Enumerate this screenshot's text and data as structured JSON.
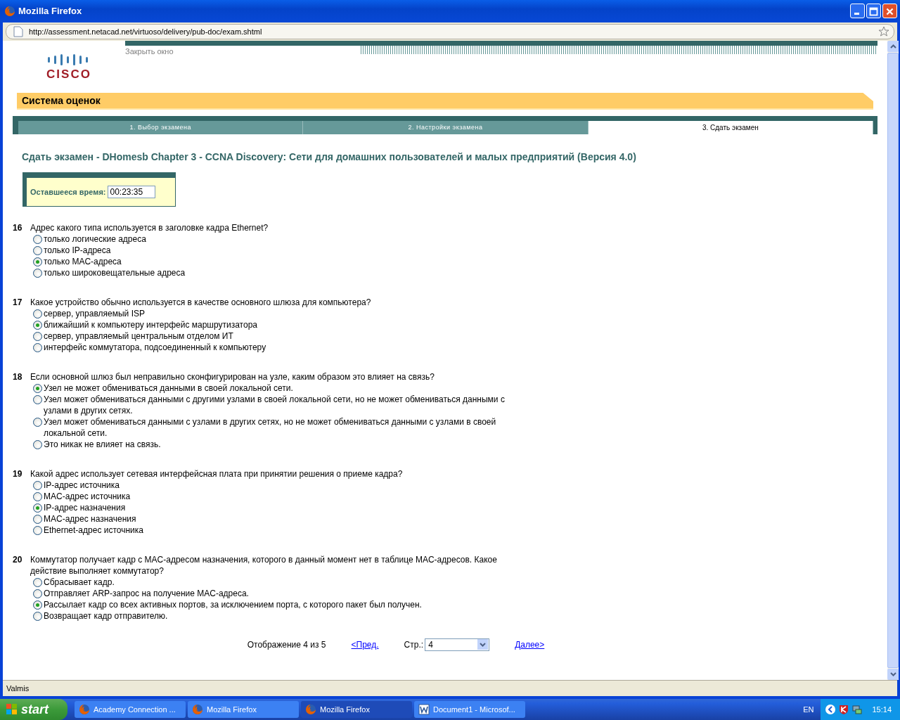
{
  "window": {
    "title": "Mozilla Firefox"
  },
  "address_bar": {
    "url": "http://assessment.netacad.net/virtuoso/delivery/pub-doc/exam.shtml"
  },
  "header": {
    "close_link": "Закрыть окно",
    "logo": "CISCO",
    "banner": "Система оценок"
  },
  "steps": [
    {
      "label": "1. Выбор экзамена",
      "selected": false
    },
    {
      "label": "2. Настройки экзамена",
      "selected": false
    },
    {
      "label": "3. Сдать экзамен",
      "selected": true
    }
  ],
  "exam_title": "Сдать экзамен - DHomesb Chapter 3 - CCNA Discovery: Сети для домашних пользователей и малых предприятий (Версия 4.0)",
  "timer": {
    "label": "Оставшееся время:",
    "value": "00:23:35"
  },
  "questions": [
    {
      "number": "16",
      "text": "Адрес какого типа используется в заголовке кадра Ethernet?",
      "options": [
        {
          "label": "только логические адреса",
          "selected": false
        },
        {
          "label": "только IP-адреса",
          "selected": false
        },
        {
          "label": "только MAC-адреса",
          "selected": true
        },
        {
          "label": "только широковещательные адреса",
          "selected": false
        }
      ]
    },
    {
      "number": "17",
      "text": "Какое устройство обычно используется в качестве основного шлюза для компьютера?",
      "options": [
        {
          "label": "сервер, управляемый ISP",
          "selected": false
        },
        {
          "label": "ближайший к компьютеру интерфейс маршрутизатора",
          "selected": true
        },
        {
          "label": "сервер, управляемый центральным отделом ИТ",
          "selected": false
        },
        {
          "label": "интерфейс коммутатора, подсоединенный к компьютеру",
          "selected": false
        }
      ]
    },
    {
      "number": "18",
      "text": "Если основной шлюз был неправильно сконфигурирован на узле, каким образом это влияет на связь?",
      "options": [
        {
          "label": "Узел не может обмениваться данными в своей локальной сети.",
          "selected": true
        },
        {
          "label": "Узел может обмениваться данными с другими узлами в своей локальной сети, но не может обмениваться данными с узлами в других сетях.",
          "selected": false
        },
        {
          "label": "Узел может обмениваться данными с узлами в других сетях, но не может обмениваться данными с узлами в своей локальной сети.",
          "selected": false
        },
        {
          "label": "Это никак не влияет на связь.",
          "selected": false
        }
      ]
    },
    {
      "number": "19",
      "text": "Какой адрес использует сетевая интерфейсная плата при принятии решения о приеме кадра?",
      "options": [
        {
          "label": "IP-адрес источника",
          "selected": false
        },
        {
          "label": "MAC-адрес источника",
          "selected": false
        },
        {
          "label": "IP-адрес назначения",
          "selected": true
        },
        {
          "label": "MAC-адрес назначения",
          "selected": false
        },
        {
          "label": "Ethernet-адрес источника",
          "selected": false
        }
      ]
    },
    {
      "number": "20",
      "text": "Коммутатор получает кадр с MAC-адресом назначения, которого в данный момент нет в таблице MAC-адресов. Какое действие выполняет коммутатор?",
      "options": [
        {
          "label": "Сбрасывает кадр.",
          "selected": false
        },
        {
          "label": "Отправляет ARP-запрос на получение MAC-адреса.",
          "selected": false
        },
        {
          "label": "Рассылает кадр со всех активных портов, за исключением порта, с которого пакет был получен.",
          "selected": true
        },
        {
          "label": "Возвращает кадр отправителю.",
          "selected": false
        }
      ]
    }
  ],
  "pagination": {
    "status": "Отображение 4 из 5",
    "prev": "<Пред.",
    "page_label": "Стр.:",
    "page": "4",
    "next": "Далее>"
  },
  "status_bar": "Valmis",
  "taskbar": {
    "start": "start",
    "items": [
      {
        "label": "Academy Connection ...",
        "kind": "firefox",
        "selected": false
      },
      {
        "label": "Mozilla Firefox",
        "kind": "firefox",
        "selected": false
      },
      {
        "label": "Mozilla Firefox",
        "kind": "firefox",
        "selected": true
      },
      {
        "label": "Document1 - Microsof...",
        "kind": "word",
        "selected": false
      }
    ],
    "language": "EN",
    "clock": "15:14"
  }
}
